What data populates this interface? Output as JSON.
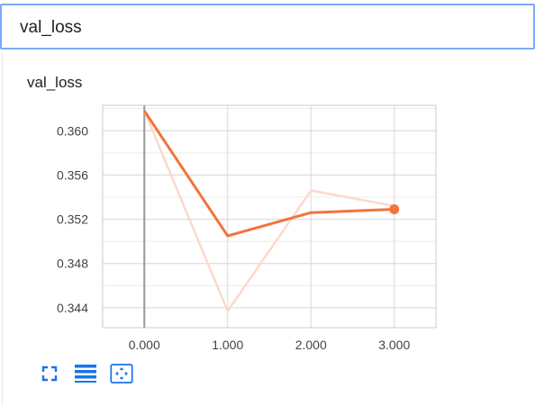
{
  "search": {
    "value": "val_loss"
  },
  "card": {
    "title": "val_loss"
  },
  "toolbar": {
    "icons": [
      "fullscreen-icon",
      "data-table-icon",
      "fit-domain-icon"
    ]
  },
  "colors": {
    "accent_line": "#f4733d",
    "raw_line": "#fcd9cc",
    "grid": "#d9d9d9",
    "icon_blue": "#1a73e8"
  },
  "chart_data": {
    "type": "line",
    "title": "val_loss",
    "xlabel": "",
    "ylabel": "",
    "x_ticks": [
      "0.000",
      "1.000",
      "2.000",
      "3.000"
    ],
    "y_ticks": [
      "0.344",
      "0.348",
      "0.352",
      "0.356",
      "0.360"
    ],
    "xlim": [
      -0.5,
      3.5
    ],
    "ylim": [
      0.3422,
      0.3623
    ],
    "grid": true,
    "series": [
      {
        "x": [
          0,
          1,
          2,
          3
        ],
        "values": [
          0.3618,
          0.3505,
          0.3526,
          0.3529
        ]
      },
      {
        "x": [
          0,
          1,
          2,
          3
        ],
        "values": [
          0.3618,
          0.3437,
          0.3546,
          0.3532
        ]
      }
    ]
  }
}
